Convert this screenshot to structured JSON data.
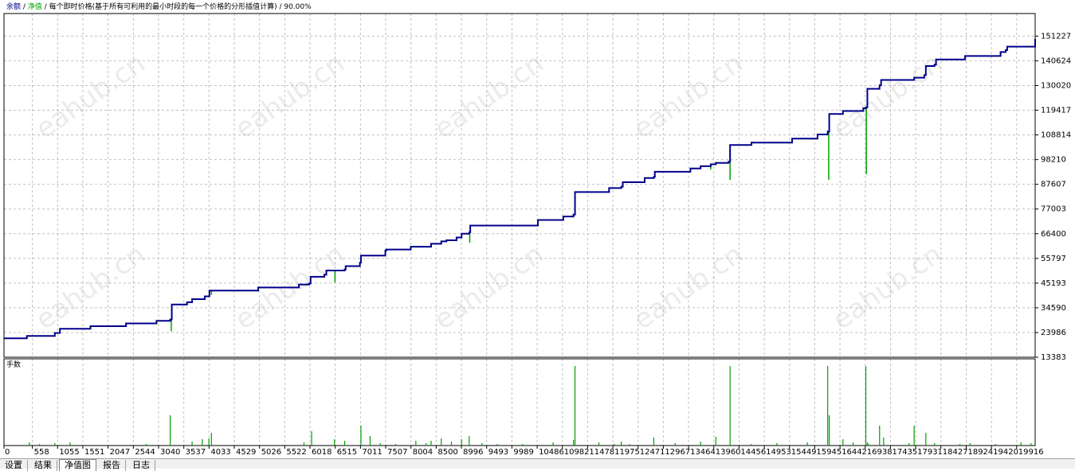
{
  "header": {
    "label_balance": "余额",
    "sep1": " / ",
    "label_equity": "净值",
    "sep2": " / ",
    "model": "每个即时价格(基于所有可利用的最小时段的每一个价格的分形插值计算)",
    "sep3": " / ",
    "quality": "90.00%"
  },
  "lower_panel_label": "手数",
  "watermark_text": "eahub.cn",
  "colors": {
    "balance": "#00008b",
    "equity": "#00a000",
    "lots": "#00a000",
    "grid": "#c0c0c0",
    "axis": "#000000",
    "watermark": "#ebebeb"
  },
  "tabs": [
    {
      "label": "设置",
      "active": false
    },
    {
      "label": "结果",
      "active": false
    },
    {
      "label": "净值图",
      "active": true
    },
    {
      "label": "报告",
      "active": false
    },
    {
      "label": "日志",
      "active": false
    }
  ],
  "chart_data": {
    "type": "line",
    "x_ticks": [
      0,
      558,
      1055,
      1551,
      2047,
      2544,
      3040,
      3537,
      4033,
      4529,
      5026,
      5522,
      6018,
      6515,
      7011,
      7507,
      8004,
      8500,
      8996,
      9493,
      9989,
      10486,
      10982,
      11478,
      11975,
      12471,
      12967,
      13464,
      13960,
      14456,
      14953,
      15449,
      15945,
      16442,
      16938,
      17435,
      17931,
      18427,
      18924,
      19420,
      19916
    ],
    "y_ticks": [
      13383,
      23986,
      34590,
      45193,
      55797,
      66400,
      77003,
      87607,
      98210,
      108814,
      119417,
      130020,
      140624,
      151227
    ],
    "xlim": [
      0,
      20280
    ],
    "ylim": [
      13383,
      155800
    ],
    "grid": true,
    "series": [
      {
        "name": "余额",
        "x": [
          0,
          450,
          1000,
          1100,
          1700,
          2400,
          3000,
          3270,
          3300,
          3600,
          3700,
          3950,
          4040,
          5000,
          5800,
          6000,
          6030,
          6300,
          6340,
          6700,
          6720,
          7000,
          7020,
          7500,
          7520,
          8000,
          8400,
          8600,
          8700,
          8900,
          9000,
          9150,
          9170,
          10500,
          11000,
          11200,
          11230,
          11900,
          12140,
          12170,
          12600,
          12780,
          12800,
          13500,
          13700,
          13900,
          14000,
          14250,
          14280,
          14700,
          15500,
          16000,
          16200,
          16230,
          16500,
          16900,
          16950,
          16980,
          17220,
          17250,
          17900,
          18100,
          18130,
          18300,
          18330,
          18900,
          19600,
          19700,
          19730,
          20280
        ],
        "y": [
          21500,
          22500,
          23800,
          25600,
          26700,
          27900,
          29000,
          29600,
          36000,
          37000,
          38300,
          39500,
          42000,
          43300,
          44600,
          45000,
          47900,
          48800,
          50600,
          51100,
          52500,
          54000,
          57000,
          59200,
          59600,
          60800,
          62100,
          63100,
          63600,
          64800,
          66400,
          67000,
          69900,
          72300,
          73800,
          74600,
          84300,
          86000,
          86600,
          88500,
          90300,
          90800,
          93000,
          94400,
          95400,
          96200,
          96800,
          97300,
          104500,
          105500,
          107200,
          109000,
          110300,
          117800,
          119100,
          120300,
          120600,
          128600,
          130100,
          132400,
          133400,
          134500,
          138400,
          139000,
          141200,
          142700,
          144400,
          145200,
          146700,
          150100
        ]
      },
      {
        "name": "净值",
        "x": [
          3290,
          4080,
          6510,
          9160,
          13900,
          14280,
          16220,
          16960
        ],
        "y": [
          24500,
          40200,
          45500,
          62500,
          94000,
          89500,
          89500,
          92000
        ]
      }
    ],
    "lots_series": {
      "name": "手数",
      "x": [
        500,
        700,
        1000,
        1300,
        2800,
        3270,
        3700,
        3900,
        4030,
        4080,
        5900,
        6050,
        6500,
        6700,
        7020,
        7200,
        7400,
        7700,
        8100,
        8300,
        8400,
        8600,
        8800,
        9000,
        9150,
        9400,
        9700,
        10200,
        10800,
        11200,
        11230,
        11700,
        12000,
        12140,
        12300,
        12780,
        13200,
        13700,
        14000,
        14280,
        14700,
        15200,
        15800,
        16200,
        16230,
        16500,
        16700,
        16950,
        16980,
        17000,
        17220,
        17300,
        17800,
        17900,
        18130,
        18300,
        18800,
        19000,
        19500,
        20000,
        20200
      ],
      "v": [
        0.04,
        0.02,
        0.03,
        0.04,
        0.02,
        0.38,
        0.05,
        0.08,
        0.09,
        0.16,
        0.04,
        0.18,
        0.08,
        0.06,
        0.25,
        0.12,
        0.03,
        0.02,
        0.06,
        0.03,
        0.06,
        0.09,
        0.05,
        0.08,
        0.12,
        0.03,
        0.02,
        0.02,
        0.04,
        0.07,
        1.0,
        0.04,
        0.02,
        0.05,
        0.02,
        0.1,
        0.03,
        0.05,
        0.11,
        1.0,
        0.02,
        0.03,
        0.04,
        1.0,
        0.38,
        0.08,
        0.04,
        1.0,
        0.04,
        0.02,
        0.25,
        0.1,
        0.03,
        0.25,
        0.16,
        0.03,
        0.02,
        0.03,
        0.02,
        0.04,
        0.03
      ]
    }
  }
}
